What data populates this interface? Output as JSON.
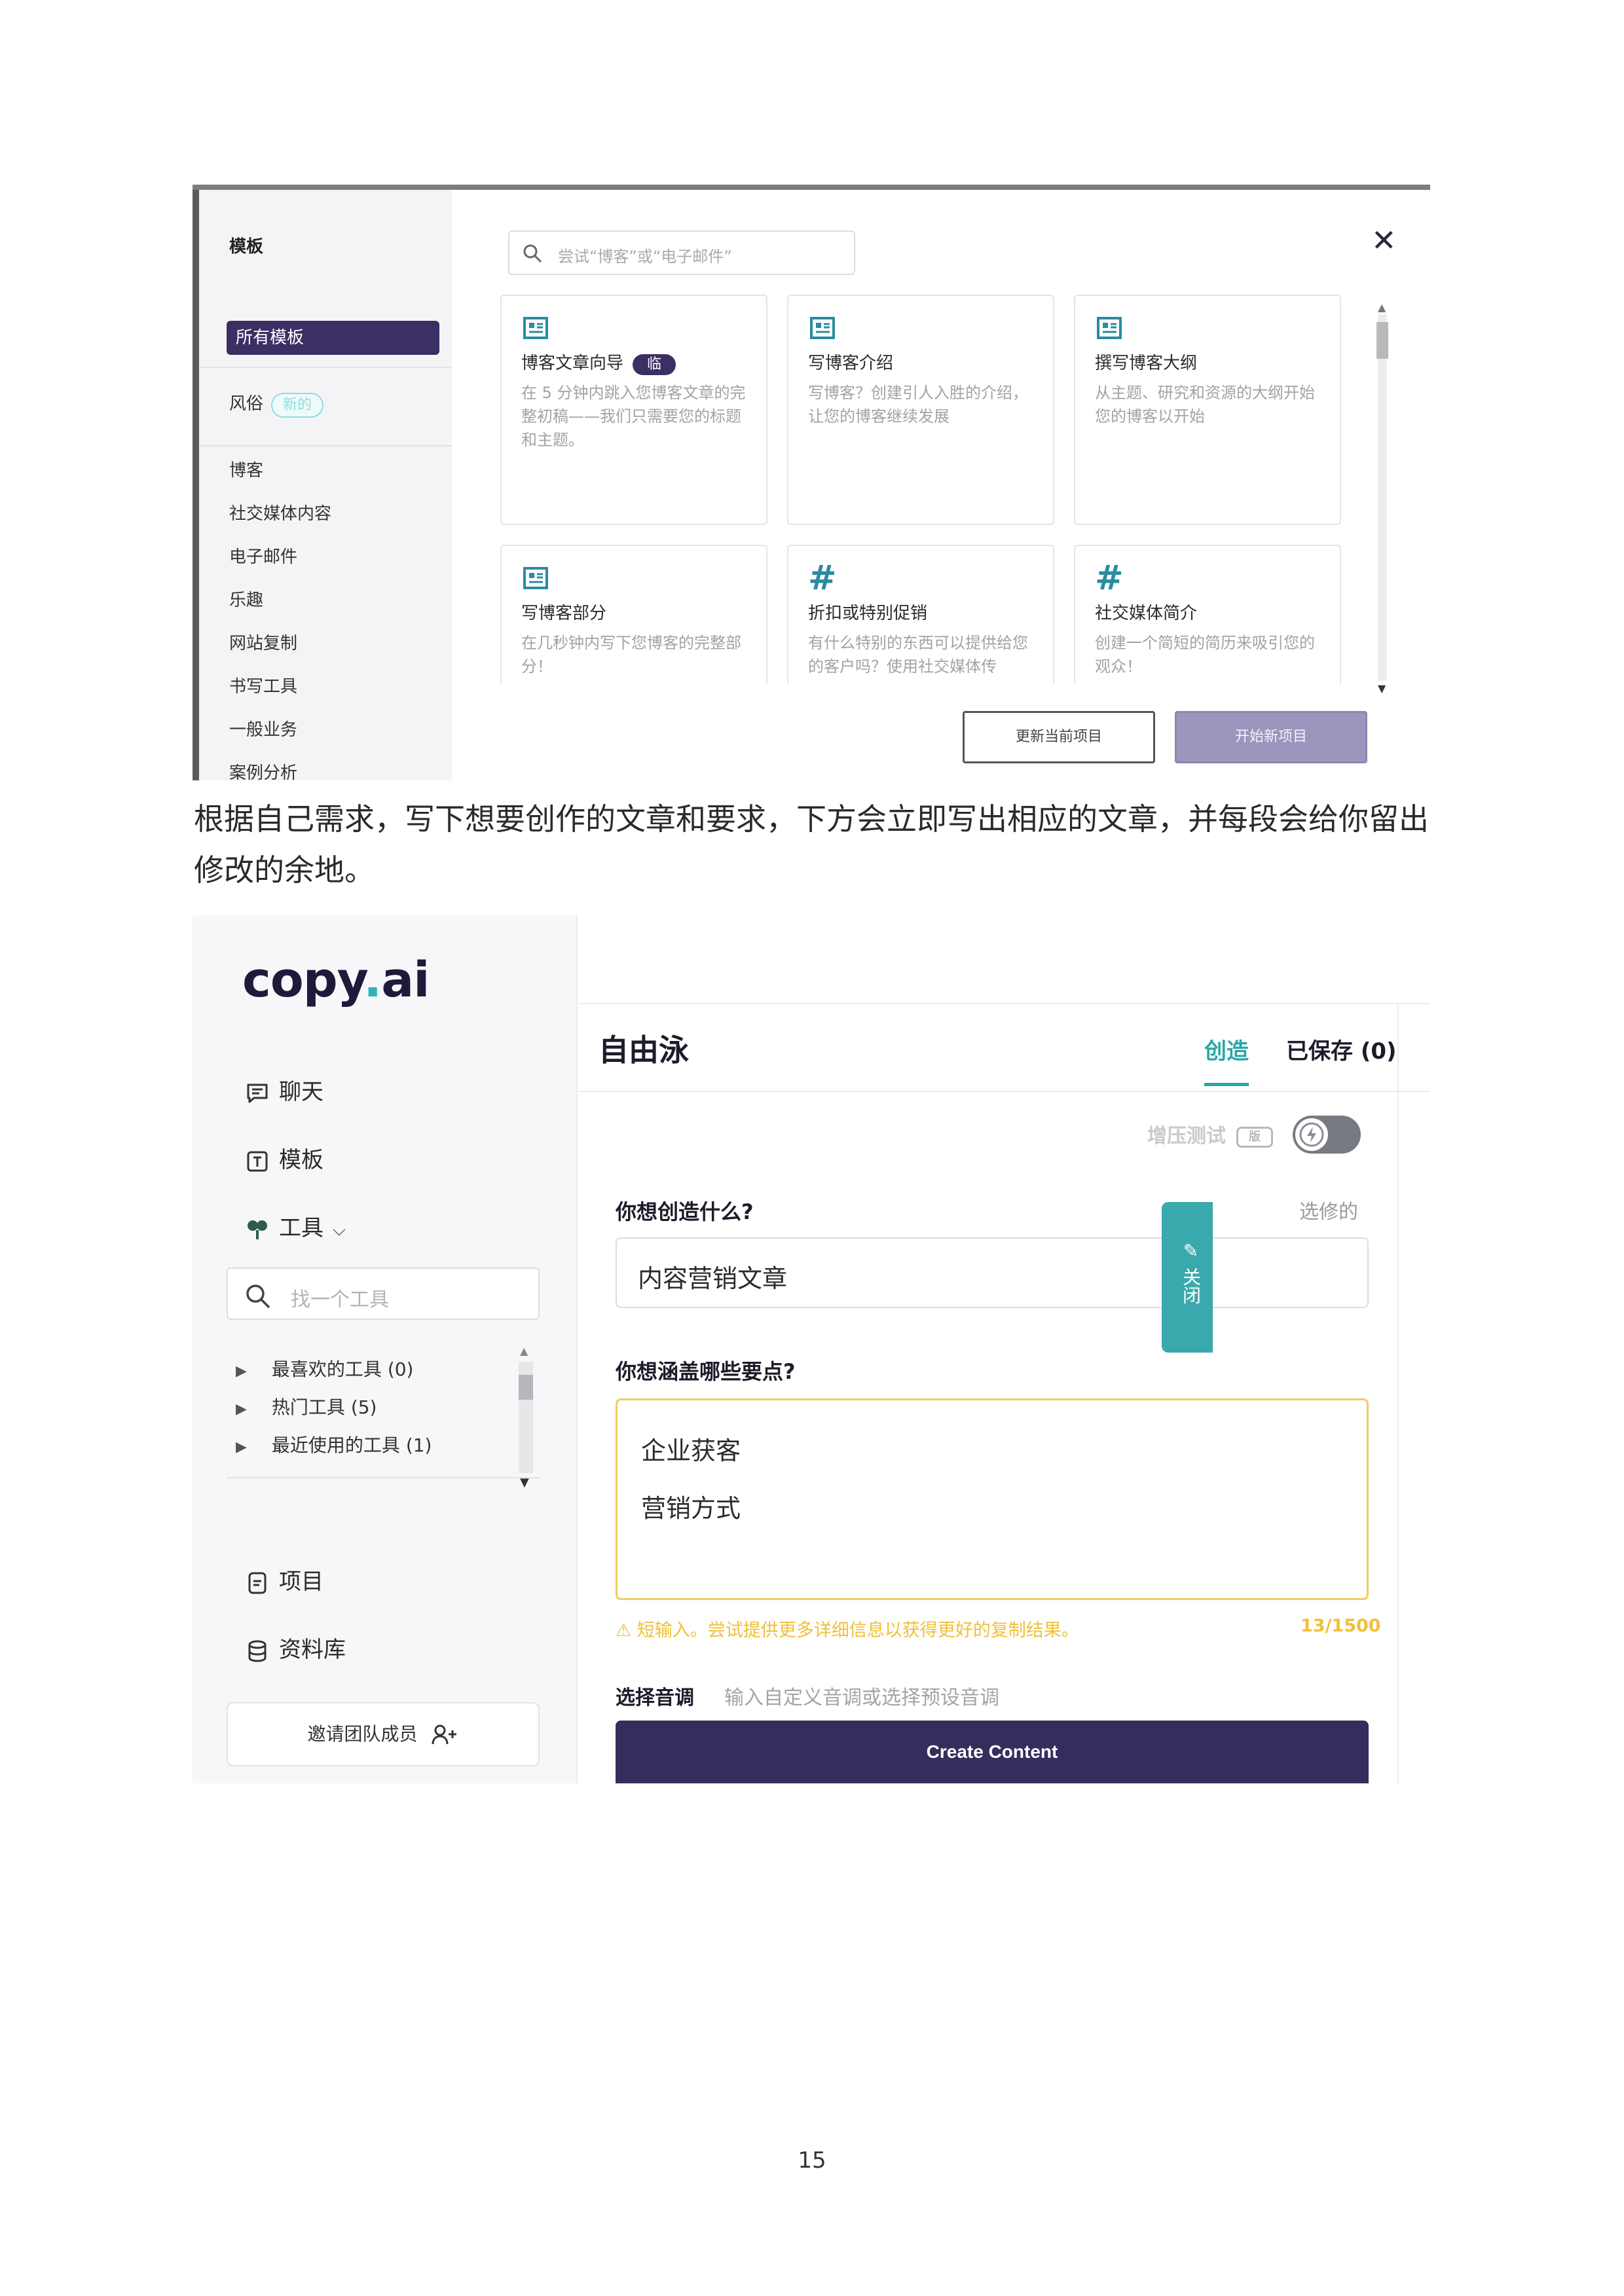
{
  "screenshot1": {
    "sidebar": {
      "title": "模板",
      "all_templates": "所有模板",
      "style_label": "风俗",
      "style_badge": "新的",
      "categories": [
        "博客",
        "社交媒体内容",
        "电子邮件",
        "乐趣",
        "网站复制",
        "书写工具",
        "一般业务",
        "案例分析"
      ]
    },
    "search": {
      "placeholder": "尝试“博客”或“电子邮件”"
    },
    "close_icon": "close-icon",
    "cards": [
      {
        "icon": "newspaper-icon",
        "title": "博客文章向导",
        "badge": "临",
        "desc": "在 5 分钟内跳入您博客文章的完整初稿——我们只需要您的标题和主题。"
      },
      {
        "icon": "newspaper-icon",
        "title": "写博客介绍",
        "desc": "写博客？创建引人入胜的介绍，让您的博客继续发展"
      },
      {
        "icon": "newspaper-icon",
        "title": "撰写博客大纲",
        "desc": "从主题、研究和资源的大纲开始您的博客以开始"
      },
      {
        "icon": "newspaper-icon",
        "title": "写博客部分",
        "desc": "在几秒钟内写下您博客的完整部分！"
      },
      {
        "icon": "hash-icon",
        "title": "折扣或特别促销",
        "desc": "有什么特别的东西可以提供给您的客户吗？使用社交媒体传"
      },
      {
        "icon": "hash-icon",
        "title": "社交媒体简介",
        "desc": "创建一个简短的简历来吸引您的观众！"
      }
    ],
    "buttons": {
      "update": "更新当前项目",
      "start": "开始新项目"
    },
    "colors": {
      "accent": "#3b2f63",
      "icon": "#2a8c9f"
    }
  },
  "paragraph": "根据自己需求，写下想要创作的文章和要求，下方会立即写出相应的文章，并每段会给你留出修改的余地。",
  "screenshot2": {
    "logo_prefix": "copy",
    "logo_dot": ".",
    "logo_suffix": "ai",
    "nav": {
      "chat": "聊天",
      "templates": "模板",
      "tools": "工具",
      "projects": "项目",
      "library": "资料库"
    },
    "find_tool_placeholder": "找一个工具",
    "tree": [
      "最喜欢的工具 (0)",
      "热门工具 (5)",
      "最近使用的工具 (1)"
    ],
    "invite": "邀请团队成员",
    "header": {
      "title": "自由泳",
      "tab_create": "创造",
      "tab_saved": "已保存 (0)"
    },
    "stress_test": "增压测试",
    "beta_badge": "版",
    "question1": "你想创造什么?",
    "question1_side": "选修的",
    "input1_value": "内容营销文章",
    "question2": "你想涵盖哪些要点?",
    "points": [
      "企业获客",
      "营销方式"
    ],
    "warning": "短输入。尝试提供更多详细信息以获得更好的复制结果。",
    "char_count": "13/1500",
    "tone_label": "选择音调",
    "tone_placeholder": "输入自定义音调或选择预设音调",
    "create_button": "Create Content",
    "close_tab": "关闭",
    "colors": {
      "teal": "#2aa6a8",
      "purple": "#372d5c",
      "warning": "#f0c037"
    }
  },
  "page_number": "15"
}
